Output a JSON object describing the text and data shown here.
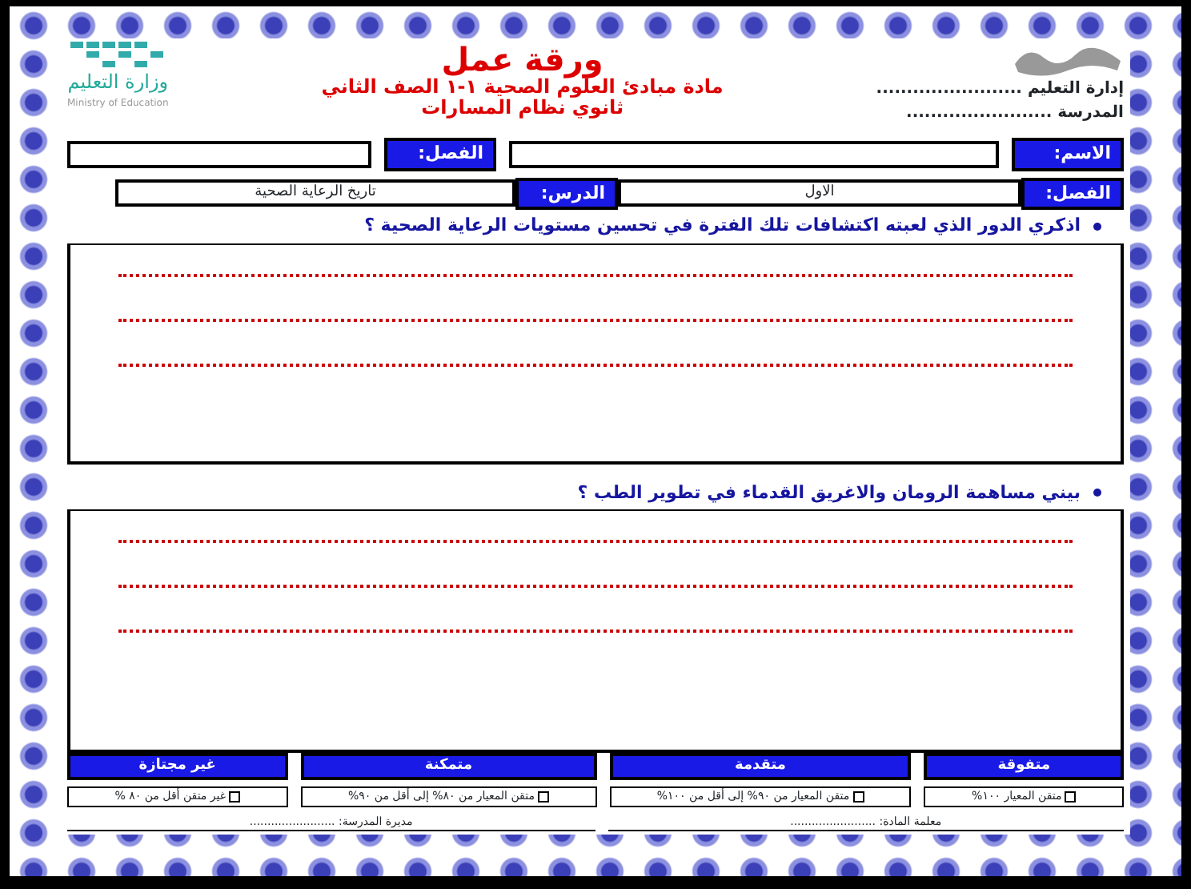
{
  "header": {
    "region_label": "إدارة التعليم ........................",
    "school_label": "المدرسة ........................",
    "title": "ورقة عمل",
    "subject": "مادة مبادئ العلوم الصحية ١-١ الصف الثاني",
    "track": "ثانوي نظام المسارات",
    "ministry": "وزارة التعليم",
    "ministry_en": "Ministry of Education"
  },
  "student_row": {
    "name_label": "الاسم:",
    "class_label": "الفصل:"
  },
  "lesson_row": {
    "term_label": "الفصل:",
    "term_value": "الاول",
    "lesson_label": "الدرس:",
    "lesson_value": "تاريخ الرعاية الصحية"
  },
  "questions": [
    {
      "text": "اذكري الدور الذي لعبته اكتشافات تلك الفترة في تحسين مستويات الرعاية الصحية ؟"
    },
    {
      "text": "بيني مساهمة الرومان والاغريق القدماء في تطوير الطب ؟"
    }
  ],
  "levels": [
    {
      "title": "متفوقة",
      "criterion": "متقن المعيار ١٠٠%",
      "checked": false
    },
    {
      "title": "متقدمة",
      "criterion": "متقن المعيار من ٩٠% إلى أقل من ١٠٠%",
      "checked": false
    },
    {
      "title": "متمكنة",
      "criterion": "متقن المعيار من ٨٠% إلى أقل من ٩٠%",
      "checked": false
    },
    {
      "title": "غير مجتازة",
      "criterion": "غير متقن أقل من ٨٠ %",
      "checked": false
    }
  ],
  "signatures": [
    {
      "label": "معلمة المادة: ........................"
    },
    {
      "label": "مديرة المدرسة: ........................"
    }
  ]
}
